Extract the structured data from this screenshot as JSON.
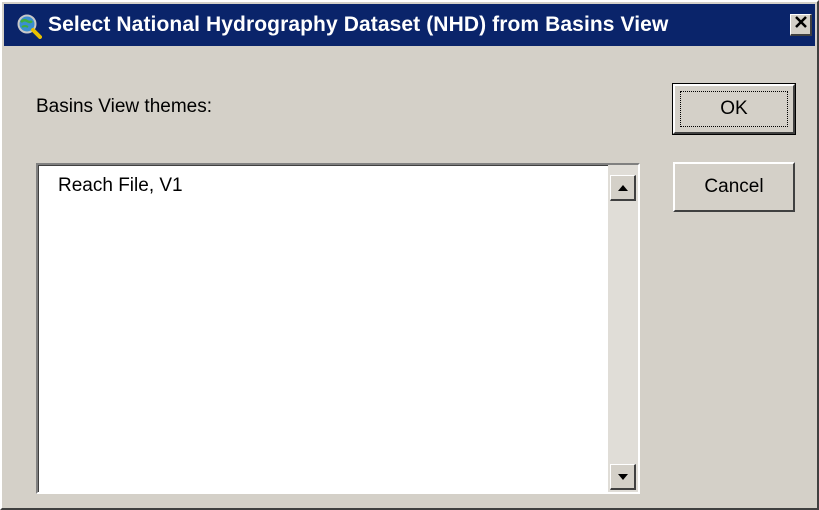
{
  "window": {
    "title": "Select National Hydrography Dataset (NHD) from Basins View",
    "app_icon": "globe-magnifier-icon",
    "close_icon": "close-icon"
  },
  "themes": {
    "label": "Basins View themes:",
    "items": [
      "Reach File, V1"
    ]
  },
  "buttons": {
    "ok_label": "OK",
    "cancel_label": "Cancel"
  },
  "colors": {
    "titlebar": "#0a246a",
    "face": "#d4d0c8"
  }
}
